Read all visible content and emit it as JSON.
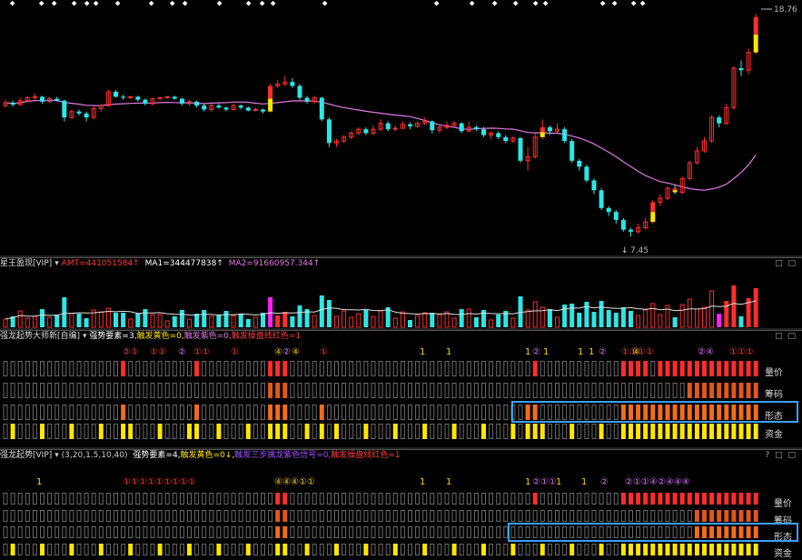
{
  "colors": {
    "up": "#ff2d2d",
    "down": "#2ee6e6",
    "ma": "#e07ae0",
    "yellow": "#ffe600",
    "orange": "#f26c1a",
    "dark_orange": "#e0581b",
    "magenta": "#ff22ff",
    "box": "#6a6a6a",
    "highlight": "#3aa0ff",
    "white": "#ffffff"
  },
  "price_chart": {
    "high_label": "18.76",
    "low_label": "7.45",
    "low_arrow": "↓",
    "top_markers": [
      14,
      46,
      60,
      82,
      96,
      106,
      130,
      167,
      190,
      204,
      242,
      274,
      289,
      301,
      358,
      481,
      520,
      545,
      568,
      590,
      601,
      664,
      677,
      698,
      708
    ],
    "candles": [
      {
        "o": 14.1,
        "c": 14.25,
        "h": 14.4,
        "l": 14.0
      },
      {
        "o": 14.25,
        "c": 14.15,
        "h": 14.35,
        "l": 14.05
      },
      {
        "o": 14.15,
        "c": 14.35,
        "h": 14.5,
        "l": 14.1
      },
      {
        "o": 14.35,
        "c": 14.5,
        "h": 14.6,
        "l": 14.3
      },
      {
        "o": 14.5,
        "c": 14.55,
        "h": 14.7,
        "l": 14.4
      },
      {
        "o": 14.55,
        "c": 14.3,
        "h": 14.6,
        "l": 14.2
      },
      {
        "o": 14.3,
        "c": 14.45,
        "h": 14.55,
        "l": 14.25
      },
      {
        "o": 14.45,
        "c": 14.35,
        "h": 14.55,
        "l": 14.3
      },
      {
        "o": 14.35,
        "c": 13.5,
        "h": 14.4,
        "l": 13.3
      },
      {
        "o": 13.5,
        "c": 13.8,
        "h": 13.9,
        "l": 13.4
      },
      {
        "o": 13.8,
        "c": 13.7,
        "h": 13.9,
        "l": 13.6
      },
      {
        "o": 13.7,
        "c": 13.5,
        "h": 13.8,
        "l": 13.3
      },
      {
        "o": 13.5,
        "c": 13.95,
        "h": 14.1,
        "l": 13.4
      },
      {
        "o": 13.95,
        "c": 14.1,
        "h": 14.2,
        "l": 13.8
      },
      {
        "o": 14.1,
        "c": 14.8,
        "h": 14.9,
        "l": 14.05
      },
      {
        "o": 14.8,
        "c": 14.55,
        "h": 14.9,
        "l": 14.5
      },
      {
        "o": 14.55,
        "c": 14.5,
        "h": 14.65,
        "l": 14.4
      },
      {
        "o": 14.5,
        "c": 14.55,
        "h": 14.6,
        "l": 14.45
      },
      {
        "o": 14.55,
        "c": 14.4,
        "h": 14.6,
        "l": 14.3
      },
      {
        "o": 14.4,
        "c": 14.2,
        "h": 14.45,
        "l": 14.1
      },
      {
        "o": 14.2,
        "c": 14.45,
        "h": 14.5,
        "l": 14.1
      },
      {
        "o": 14.45,
        "c": 14.5,
        "h": 14.55,
        "l": 14.4
      },
      {
        "o": 14.5,
        "c": 14.55,
        "h": 14.6,
        "l": 14.45
      },
      {
        "o": 14.55,
        "c": 14.45,
        "h": 14.6,
        "l": 14.4
      },
      {
        "o": 14.45,
        "c": 14.2,
        "h": 14.5,
        "l": 14.1
      },
      {
        "o": 14.2,
        "c": 14.3,
        "h": 14.4,
        "l": 14.1
      },
      {
        "o": 14.3,
        "c": 14.1,
        "h": 14.35,
        "l": 14.0
      },
      {
        "o": 14.1,
        "c": 13.9,
        "h": 14.2,
        "l": 13.8
      },
      {
        "o": 13.9,
        "c": 14.1,
        "h": 14.2,
        "l": 13.8
      },
      {
        "o": 14.1,
        "c": 14.0,
        "h": 14.2,
        "l": 13.95
      },
      {
        "o": 14.0,
        "c": 13.9,
        "h": 14.05,
        "l": 13.8
      },
      {
        "o": 13.9,
        "c": 14.1,
        "h": 14.2,
        "l": 13.85
      },
      {
        "o": 14.1,
        "c": 14.0,
        "h": 14.15,
        "l": 13.9
      },
      {
        "o": 14.0,
        "c": 13.85,
        "h": 14.05,
        "l": 13.8
      },
      {
        "o": 13.85,
        "c": 13.9,
        "h": 14.0,
        "l": 13.8
      },
      {
        "o": 13.9,
        "c": 13.8,
        "h": 13.95,
        "l": 13.7
      },
      {
        "o": 13.8,
        "c": 15.1,
        "h": 15.2,
        "l": 13.75
      },
      {
        "o": 15.1,
        "c": 15.2,
        "h": 15.4,
        "l": 15.0
      },
      {
        "o": 15.2,
        "c": 15.3,
        "h": 15.6,
        "l": 15.1
      },
      {
        "o": 15.3,
        "c": 15.1,
        "h": 15.5,
        "l": 15.0
      },
      {
        "o": 15.1,
        "c": 14.5,
        "h": 15.2,
        "l": 14.4
      },
      {
        "o": 14.5,
        "c": 14.3,
        "h": 14.6,
        "l": 14.2
      },
      {
        "o": 14.3,
        "c": 14.5,
        "h": 14.6,
        "l": 14.2
      },
      {
        "o": 14.5,
        "c": 13.4,
        "h": 14.55,
        "l": 13.3
      },
      {
        "o": 13.4,
        "c": 12.2,
        "h": 13.5,
        "l": 12.0
      },
      {
        "o": 12.2,
        "c": 12.3,
        "h": 12.4,
        "l": 12.0
      },
      {
        "o": 12.3,
        "c": 12.5,
        "h": 12.6,
        "l": 12.2
      },
      {
        "o": 12.5,
        "c": 12.7,
        "h": 12.8,
        "l": 12.4
      },
      {
        "o": 12.7,
        "c": 12.9,
        "h": 13.0,
        "l": 12.6
      },
      {
        "o": 12.9,
        "c": 12.7,
        "h": 13.0,
        "l": 12.6
      },
      {
        "o": 12.7,
        "c": 12.9,
        "h": 13.1,
        "l": 12.6
      },
      {
        "o": 12.9,
        "c": 13.2,
        "h": 13.4,
        "l": 12.8
      },
      {
        "o": 13.2,
        "c": 12.9,
        "h": 13.3,
        "l": 12.8
      },
      {
        "o": 12.9,
        "c": 12.95,
        "h": 13.1,
        "l": 12.8
      },
      {
        "o": 12.95,
        "c": 13.15,
        "h": 13.3,
        "l": 12.9
      },
      {
        "o": 13.15,
        "c": 13.05,
        "h": 13.25,
        "l": 12.9
      },
      {
        "o": 13.05,
        "c": 13.2,
        "h": 13.3,
        "l": 12.95
      },
      {
        "o": 13.2,
        "c": 13.3,
        "h": 13.5,
        "l": 13.1
      },
      {
        "o": 13.3,
        "c": 12.85,
        "h": 13.35,
        "l": 12.7
      },
      {
        "o": 12.85,
        "c": 13.0,
        "h": 13.1,
        "l": 12.7
      },
      {
        "o": 13.0,
        "c": 13.1,
        "h": 13.3,
        "l": 12.9
      },
      {
        "o": 13.1,
        "c": 13.2,
        "h": 13.3,
        "l": 13.0
      },
      {
        "o": 13.2,
        "c": 12.8,
        "h": 13.25,
        "l": 12.7
      },
      {
        "o": 12.8,
        "c": 13.0,
        "h": 13.3,
        "l": 12.75
      },
      {
        "o": 13.0,
        "c": 12.9,
        "h": 13.1,
        "l": 12.8
      },
      {
        "o": 12.9,
        "c": 12.6,
        "h": 13.0,
        "l": 12.5
      },
      {
        "o": 12.6,
        "c": 12.7,
        "h": 12.8,
        "l": 12.4
      },
      {
        "o": 12.7,
        "c": 12.5,
        "h": 12.8,
        "l": 12.4
      },
      {
        "o": 12.5,
        "c": 12.3,
        "h": 12.6,
        "l": 12.2
      },
      {
        "o": 12.3,
        "c": 12.45,
        "h": 12.55,
        "l": 12.2
      },
      {
        "o": 12.45,
        "c": 11.3,
        "h": 12.5,
        "l": 11.2
      },
      {
        "o": 11.3,
        "c": 11.5,
        "h": 12.0,
        "l": 10.8
      },
      {
        "o": 11.5,
        "c": 12.5,
        "h": 12.7,
        "l": 11.4
      },
      {
        "o": 12.5,
        "c": 13.0,
        "h": 13.4,
        "l": 12.4
      },
      {
        "o": 13.0,
        "c": 12.8,
        "h": 13.1,
        "l": 12.6
      },
      {
        "o": 12.8,
        "c": 12.9,
        "h": 13.2,
        "l": 12.7
      },
      {
        "o": 12.9,
        "c": 12.3,
        "h": 13.0,
        "l": 12.2
      },
      {
        "o": 12.3,
        "c": 11.3,
        "h": 12.4,
        "l": 11.2
      },
      {
        "o": 11.3,
        "c": 11.0,
        "h": 11.4,
        "l": 10.8
      },
      {
        "o": 11.0,
        "c": 10.3,
        "h": 11.1,
        "l": 10.2
      },
      {
        "o": 10.3,
        "c": 9.8,
        "h": 10.4,
        "l": 9.6
      },
      {
        "o": 9.8,
        "c": 8.9,
        "h": 9.9,
        "l": 8.8
      },
      {
        "o": 8.9,
        "c": 8.7,
        "h": 9.0,
        "l": 8.5
      },
      {
        "o": 8.7,
        "c": 8.3,
        "h": 8.8,
        "l": 8.1
      },
      {
        "o": 8.3,
        "c": 7.8,
        "h": 8.4,
        "l": 7.7
      },
      {
        "o": 7.8,
        "c": 7.7,
        "h": 7.9,
        "l": 7.45
      },
      {
        "o": 7.7,
        "c": 7.9,
        "h": 8.1,
        "l": 7.6
      },
      {
        "o": 7.9,
        "c": 8.2,
        "h": 8.4,
        "l": 7.8
      },
      {
        "o": 8.2,
        "c": 9.2,
        "h": 9.3,
        "l": 8.1
      },
      {
        "o": 9.2,
        "c": 9.4,
        "h": 9.6,
        "l": 9.0
      },
      {
        "o": 9.4,
        "c": 9.9,
        "h": 10.0,
        "l": 9.3
      },
      {
        "o": 9.9,
        "c": 9.7,
        "h": 10.1,
        "l": 9.6
      },
      {
        "o": 9.7,
        "c": 10.4,
        "h": 10.5,
        "l": 9.6
      },
      {
        "o": 10.4,
        "c": 11.2,
        "h": 11.3,
        "l": 10.3
      },
      {
        "o": 11.2,
        "c": 11.8,
        "h": 12.0,
        "l": 11.1
      },
      {
        "o": 11.8,
        "c": 12.3,
        "h": 12.5,
        "l": 11.7
      },
      {
        "o": 12.3,
        "c": 13.5,
        "h": 13.6,
        "l": 12.2
      },
      {
        "o": 13.5,
        "c": 13.2,
        "h": 13.6,
        "l": 13.0
      },
      {
        "o": 13.2,
        "c": 14.0,
        "h": 14.2,
        "l": 13.1
      },
      {
        "o": 14.0,
        "c": 16.0,
        "h": 16.1,
        "l": 13.9
      },
      {
        "o": 16.0,
        "c": 15.9,
        "h": 16.4,
        "l": 15.6
      },
      {
        "o": 15.9,
        "c": 16.8,
        "h": 17.0,
        "l": 15.7
      },
      {
        "o": 16.8,
        "c": 18.6,
        "h": 18.76,
        "l": 16.7
      }
    ],
    "yellow_marked": [
      36,
      73,
      88,
      91,
      102,
      103,
      105
    ]
  },
  "volume_panel": {
    "indicator_name": "星王盈现[VIP]",
    "amt": "AMT=441051584↑",
    "ma1": "MA1=344477838↑",
    "ma2": "MA2=91660957.344↑"
  },
  "panel1": {
    "title": "强龙起势大师新[自编]",
    "params": "",
    "factor": "强势要素=3,",
    "yellow": "触发黄色=0,",
    "purple": "触发紫色=0,",
    "red": "触发操盘线红色=1",
    "row_labels": [
      "量价",
      "筹码",
      "形态",
      "资金"
    ],
    "signals": [
      "②",
      "①",
      "①①",
      "②",
      "①①",
      "①",
      "④",
      "②",
      "④",
      "①",
      "1",
      "1",
      "1",
      "②",
      "1",
      "1",
      "1",
      "②",
      "①①①①",
      "④",
      "②④",
      "①①①"
    ]
  },
  "panel2": {
    "title": "强龙起势[VIP]",
    "params": "(3,20,1.5,10,40)",
    "factor": "强势要素=4,",
    "yellow": "触发黄色=0↓,",
    "purple": "触发三步擒龙紫色信号=0,",
    "red": "触发操盘线红色=1",
    "row_labels": [
      "量价",
      "筹码",
      "形态",
      "资金"
    ],
    "signals": [
      "1",
      "①①①①①①①①①",
      "④④④①①",
      "1",
      "1",
      "1",
      "1",
      "②①①",
      "1",
      "②",
      "②①①④②④④④"
    ]
  },
  "ctl_icons": {
    "restore": "□",
    "close": "□",
    "help": "?"
  }
}
